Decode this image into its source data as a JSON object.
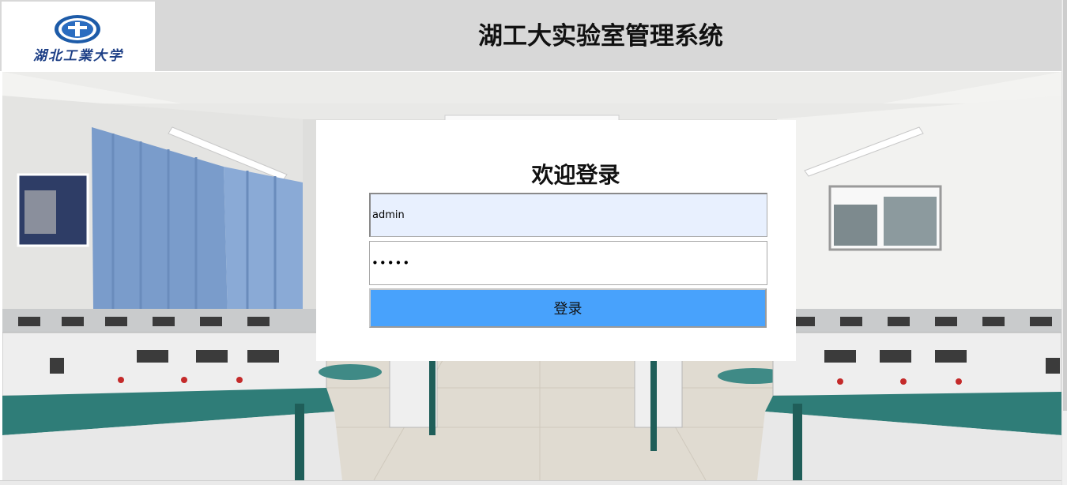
{
  "header": {
    "logo_text": "湖北工業大学",
    "title": "湖工大实验室管理系统"
  },
  "login": {
    "title": "欢迎登录",
    "username_value": "admin",
    "password_value": "•••••",
    "submit_label": "登录"
  },
  "colors": {
    "header_bg": "#d8d8d8",
    "button_bg": "#48a2fc",
    "autofill_bg": "#e8f0fe",
    "brand_blue": "#1d3f86"
  }
}
